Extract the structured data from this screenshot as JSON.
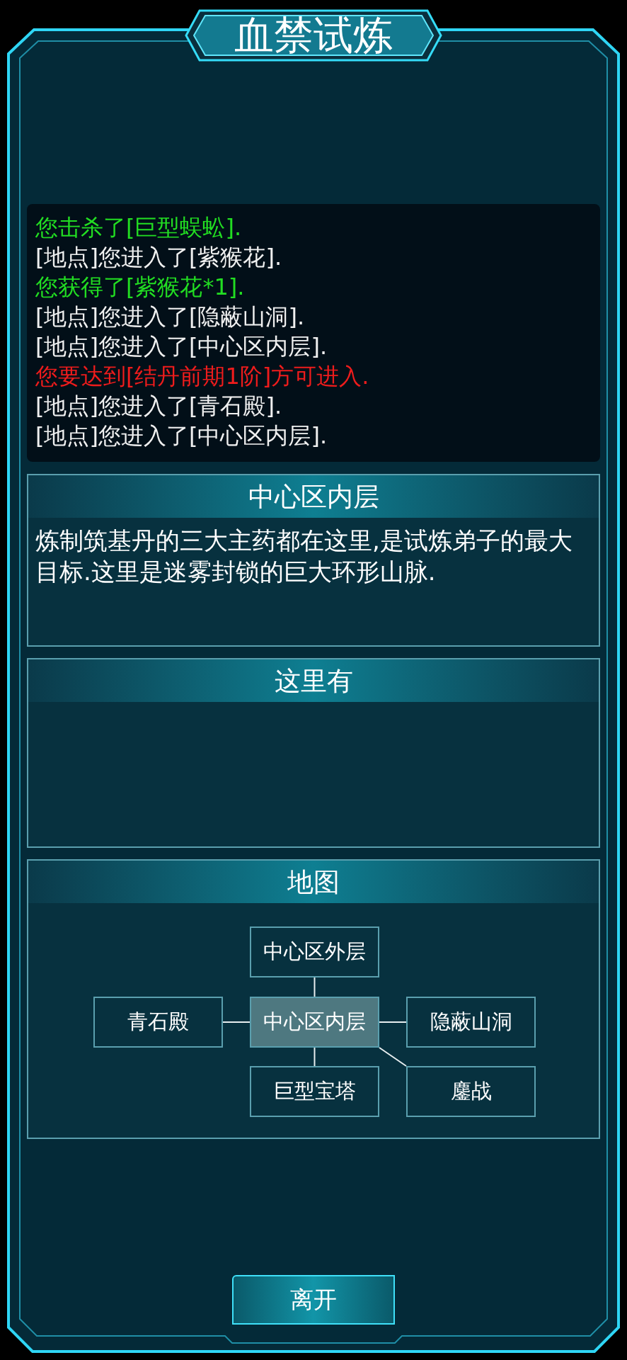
{
  "title": "血禁试炼",
  "log": [
    {
      "kind": "combat",
      "text": "您击杀了[巨型蜈蚣]."
    },
    {
      "kind": "location",
      "text": "[地点]您进入了[紫猴花]."
    },
    {
      "kind": "loot",
      "text": "您获得了[紫猴花*1]."
    },
    {
      "kind": "location",
      "text": "[地点]您进入了[隐蔽山洞]."
    },
    {
      "kind": "location",
      "text": "[地点]您进入了[中心区内层]."
    },
    {
      "kind": "warning",
      "text": "您要达到[结丹前期1阶]方可进入."
    },
    {
      "kind": "location",
      "text": "[地点]您进入了[青石殿]."
    },
    {
      "kind": "location",
      "text": "[地点]您进入了[中心区内层]."
    }
  ],
  "location": {
    "title": "中心区内层",
    "description": "炼制筑基丹的三大主药都在这里,是试炼弟子的最大目标.这里是迷雾封锁的巨大环形山脉."
  },
  "here": {
    "title": "这里有"
  },
  "map": {
    "title": "地图",
    "nodes": [
      {
        "kind": "up",
        "label": "中心区外层",
        "selected": false
      },
      {
        "kind": "left",
        "label": "青石殿",
        "selected": false
      },
      {
        "kind": "center",
        "label": "中心区内层",
        "selected": true
      },
      {
        "kind": "right",
        "label": "隐蔽山洞",
        "selected": false
      },
      {
        "kind": "down",
        "label": "巨型宝塔",
        "selected": false
      },
      {
        "kind": "down_right",
        "label": "鏖战",
        "selected": false
      }
    ]
  },
  "leave_button": "离开"
}
